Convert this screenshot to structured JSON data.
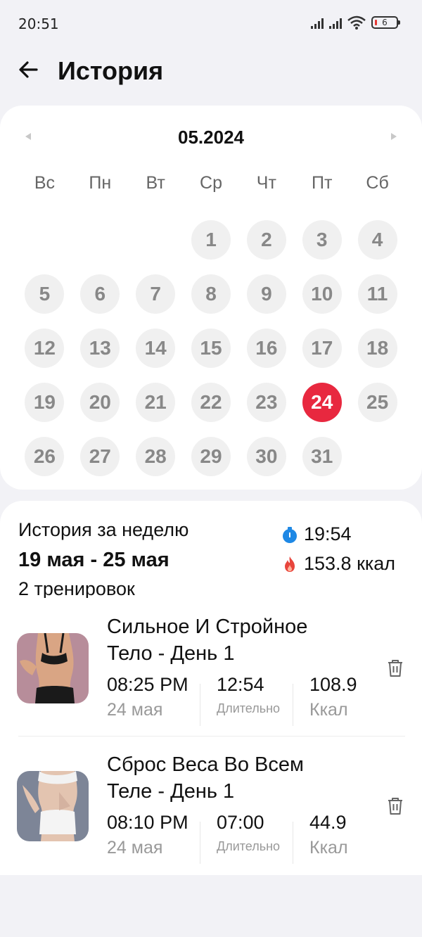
{
  "status_bar": {
    "time": "20:51",
    "battery": "6"
  },
  "header": {
    "title": "История"
  },
  "calendar": {
    "month": "05.2024",
    "weekdays": [
      "Вс",
      "Пн",
      "Вт",
      "Ср",
      "Чт",
      "Пт",
      "Сб"
    ],
    "days": [
      "1",
      "2",
      "3",
      "4",
      "5",
      "6",
      "7",
      "8",
      "9",
      "10",
      "11",
      "12",
      "13",
      "14",
      "15",
      "16",
      "17",
      "18",
      "19",
      "20",
      "21",
      "22",
      "23",
      "24",
      "25",
      "26",
      "27",
      "28",
      "29",
      "30",
      "31"
    ],
    "selected_day": "24",
    "accent_color": "#e8283f"
  },
  "history": {
    "week_label": "История за неделю",
    "week_range": "19 мая - 25 мая",
    "workout_count": "2 тренировок",
    "total_time": "19:54",
    "total_kcal": "153.8 ккал",
    "workouts": [
      {
        "title": "Сильное И Стройное Тело - День 1",
        "time": "08:25 PM",
        "date": "24 мая",
        "duration": "12:54",
        "duration_label": "Длительно",
        "kcal": "108.9",
        "kcal_label": "Ккал"
      },
      {
        "title": "Сброс Веса Во Всем Теле - День 1",
        "time": "08:10 PM",
        "date": "24 мая",
        "duration": "07:00",
        "duration_label": "Длительно",
        "kcal": "44.9",
        "kcal_label": "Ккал"
      }
    ]
  }
}
